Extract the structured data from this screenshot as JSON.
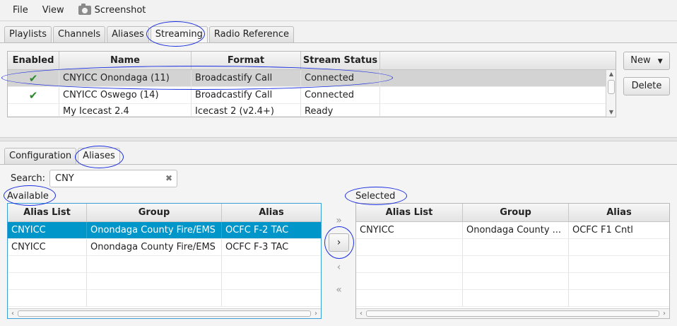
{
  "menu": {
    "file": "File",
    "view": "View",
    "screenshot": "Screenshot"
  },
  "top_tabs": [
    "Playlists",
    "Channels",
    "Aliases",
    "Streaming",
    "Radio Reference"
  ],
  "top_tabs_active": "Streaming",
  "streams": {
    "columns": [
      "Enabled",
      "Name",
      "Format",
      "Stream Status"
    ],
    "rows": [
      {
        "enabled": true,
        "name": "CNYICC Onondaga (11)",
        "format": "Broadcastify Call",
        "status": "Connected",
        "selected": true
      },
      {
        "enabled": true,
        "name": "CNYICC Oswego (14)",
        "format": "Broadcastify Call",
        "status": "Connected",
        "selected": false
      },
      {
        "enabled": false,
        "name": "My Icecast 2.4",
        "format": "Icecast 2 (v2.4+)",
        "status": "Ready",
        "selected": false
      }
    ],
    "enabled_icon": "checkmark-icon"
  },
  "buttons": {
    "new": "New",
    "delete": "Delete"
  },
  "bottom_tabs": [
    "Configuration",
    "Aliases"
  ],
  "bottom_tabs_active": "Aliases",
  "search": {
    "label": "Search:",
    "value": "CNY",
    "clear_icon": "clear-x-icon"
  },
  "available": {
    "label": "Available",
    "columns": [
      "Alias List",
      "Group",
      "Alias"
    ],
    "rows": [
      {
        "list": "CNYICC",
        "group": "Onondaga County Fire/EMS",
        "alias": "OCFC F-2 TAC",
        "selected": true
      },
      {
        "list": "CNYICC",
        "group": "Onondaga County Fire/EMS",
        "alias": "OCFC F-3 TAC",
        "selected": false
      }
    ]
  },
  "selected": {
    "label": "Selected",
    "columns": [
      "Alias List",
      "Group",
      "Alias"
    ],
    "rows": [
      {
        "list": "CNYICC",
        "group": "Onondaga County ...",
        "alias": "OCFC F1 Cntl"
      }
    ]
  },
  "move_buttons": {
    "all_right": "»",
    "right": "›",
    "left": "‹",
    "all_left": "«"
  },
  "colors": {
    "selection_blue": "#0096c9",
    "annotation_blue": "#1a2ee0",
    "check_green": "#2a8a2a"
  }
}
